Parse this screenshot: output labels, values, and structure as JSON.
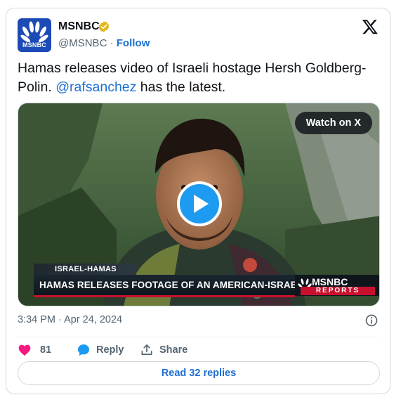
{
  "account": {
    "name": "MSNBC",
    "handle": "@MSNBC",
    "separator": " · ",
    "follow_label": "Follow",
    "avatar_text": "MSNBC",
    "verified_color": "#e2b719"
  },
  "tweet": {
    "text_before": "Hamas releases video of Israeli hostage Hersh Goldberg-Polin. ",
    "mention": "@rafsanchez",
    "text_after": " has the latest.",
    "timestamp": "3:34 PM · Apr 24, 2024"
  },
  "media": {
    "watch_label": "Watch on X",
    "chyron_top": "ISRAEL-HAMAS WAR",
    "chyron_main": "HAMAS RELEASES FOOTAGE OF AN AMERICAN-ISRAELI HOSTAGE",
    "chyron_brand": "MSNBC",
    "chyron_reports": "REPORTS"
  },
  "actions": {
    "like_count": "81",
    "reply_label": "Reply",
    "share_label": "Share",
    "read_replies_label": "Read 32 replies"
  },
  "colors": {
    "accent": "#1d6fd1",
    "like": "#f91880",
    "play": "#1d9bf0"
  }
}
